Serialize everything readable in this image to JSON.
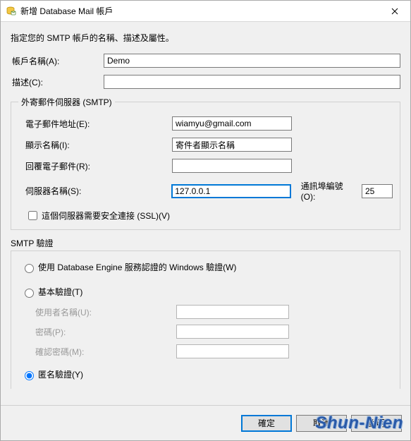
{
  "window": {
    "title": "新增 Database Mail 帳戶"
  },
  "instruction": "指定您的 SMTP 帳戶的名稱、描述及屬性。",
  "account": {
    "name_label": "帳戶名稱(A):",
    "name_value": "Demo",
    "desc_label": "描述(C):",
    "desc_value": ""
  },
  "smtp": {
    "legend": "外寄郵件伺服器 (SMTP)",
    "email_label": "電子郵件地址(E):",
    "email_value": "wiamyu@gmail.com",
    "display_label": "顯示名稱(I):",
    "display_value": "寄件者顯示名稱",
    "reply_label": "回覆電子郵件(R):",
    "reply_value": "",
    "server_label": "伺服器名稱(S):",
    "server_value": "127.0.0.1",
    "port_label": "通訊埠編號(O):",
    "port_value": "25",
    "ssl_label": "這個伺服器需要安全連接 (SSL)(V)"
  },
  "auth": {
    "legend": "SMTP 驗證",
    "windows_label": "使用 Database Engine 服務認證的 Windows 驗證(W)",
    "basic_label": "基本驗證(T)",
    "user_label": "使用者名稱(U):",
    "user_value": "",
    "pass_label": "密碼(P):",
    "pass_value": "",
    "confirm_label": "確認密碼(M):",
    "confirm_value": "",
    "anon_label": "匿名驗證(Y)"
  },
  "footer": {
    "ok": "確定",
    "cancel": "取消",
    "help": "說明"
  },
  "watermark": "Shun-Nien"
}
